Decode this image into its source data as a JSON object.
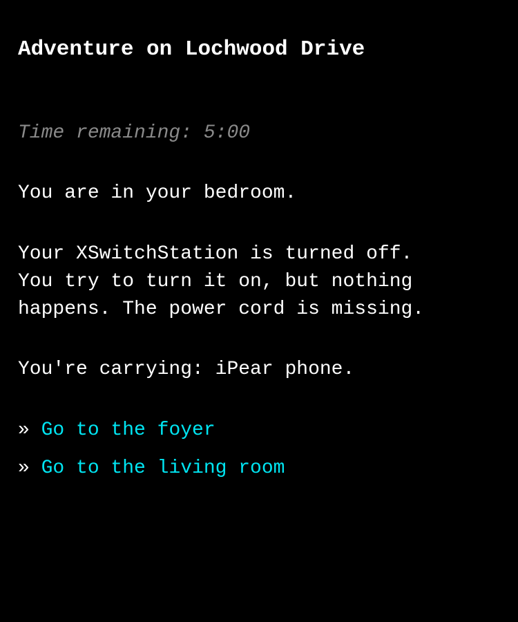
{
  "game": {
    "title": "Adventure on Lochwood Drive",
    "timer": "Time remaining: 5:00",
    "location": "You are in your bedroom.",
    "description": "Your XSwitchStation is turned off.\nYou try to turn it on, but nothing\nhappens. The power cord is missing.",
    "inventory": "You're carrying: iPear phone.",
    "choices": [
      {
        "marker": "»",
        "label": "Go to the foyer"
      },
      {
        "marker": "»",
        "label": "Go to the living room"
      }
    ]
  },
  "colors": {
    "background": "#000000",
    "text": "#ffffff",
    "timer": "#8a8a8a",
    "link": "#00e5f2"
  }
}
